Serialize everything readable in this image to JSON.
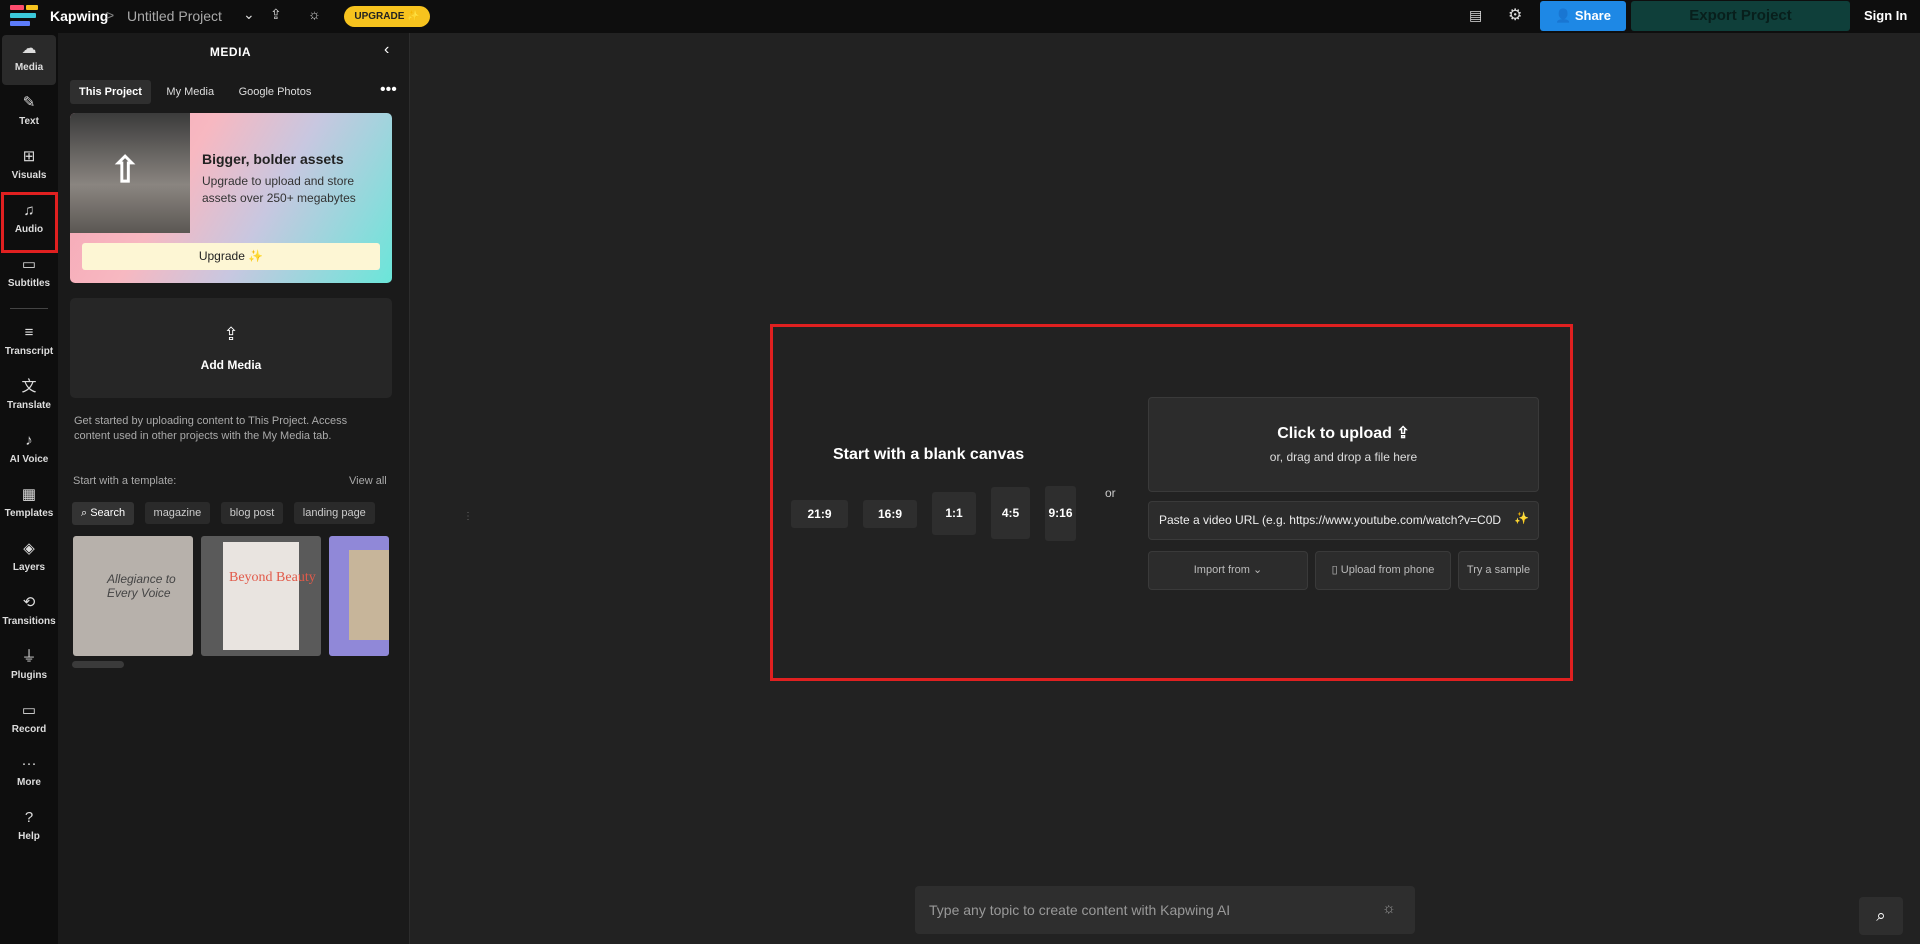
{
  "topbar": {
    "brand": "Kapwing",
    "separator": ">",
    "project_title": "Untitled Project",
    "upgrade_label": "UPGRADE ✨",
    "share_label": "Share",
    "export_label": "Export Project",
    "signin_label": "Sign In",
    "icons": [
      "chevron-down-icon",
      "upload-icon",
      "lightbulb-icon",
      "comment-icon",
      "gear-icon",
      "add-user-icon"
    ]
  },
  "rail": {
    "items": [
      {
        "label": "Media",
        "icon": "cloud-upload-icon"
      },
      {
        "label": "Text",
        "icon": "text-edit-icon"
      },
      {
        "label": "Visuals",
        "icon": "shapes-icon"
      },
      {
        "label": "Audio",
        "icon": "music-note-icon"
      },
      {
        "label": "Subtitles",
        "icon": "subtitles-icon"
      },
      {
        "label": "Transcript",
        "icon": "transcript-icon"
      },
      {
        "label": "Translate",
        "icon": "translate-icon"
      },
      {
        "label": "AI Voice",
        "icon": "ai-voice-icon"
      },
      {
        "label": "Templates",
        "icon": "templates-icon"
      },
      {
        "label": "Layers",
        "icon": "layers-icon"
      },
      {
        "label": "Transitions",
        "icon": "transitions-icon"
      },
      {
        "label": "Plugins",
        "icon": "plugin-icon"
      },
      {
        "label": "Record",
        "icon": "camera-icon"
      },
      {
        "label": "More",
        "icon": "more-dots-icon"
      },
      {
        "label": "Help",
        "icon": "help-icon"
      }
    ]
  },
  "panel": {
    "title": "MEDIA",
    "tabs": [
      "This Project",
      "My Media",
      "Google Photos"
    ],
    "promo": {
      "title": "Bigger, bolder assets",
      "subtitle": "Upgrade to upload and store assets over 250+ megabytes",
      "button": "Upgrade ✨"
    },
    "add_media_label": "Add Media",
    "help_text": "Get started by uploading content to This Project. Access content used in other projects with the My Media tab.",
    "template_heading": "Start with a template:",
    "view_all": "View all",
    "chips": [
      "Search",
      "magazine",
      "blog post",
      "landing page"
    ],
    "thumbs": [
      {
        "text": "Allegiance to Every Voice"
      },
      {
        "text": "Beyond Beauty"
      },
      {
        "text": ""
      }
    ]
  },
  "canvas": {
    "blank_title": "Start with a blank canvas",
    "ratios": [
      "21:9",
      "16:9",
      "1:1",
      "4:5",
      "9:16"
    ],
    "or_label": "or",
    "upload_title": "Click to upload",
    "upload_sub": "or, drag and drop a file here",
    "url_placeholder": "Paste a video URL (e.g. https://www.youtube.com/watch?v=C0D",
    "import_label": "Import from",
    "phone_label": "Upload from phone",
    "sample_label": "Try a sample"
  },
  "ai": {
    "placeholder": "Type any topic to create content with Kapwing AI"
  },
  "colors": {
    "accent_blue": "#1e88e5",
    "upgrade_yellow": "#f7c31e",
    "highlight_red": "#e02020",
    "export_green": "#0f3f3a"
  }
}
